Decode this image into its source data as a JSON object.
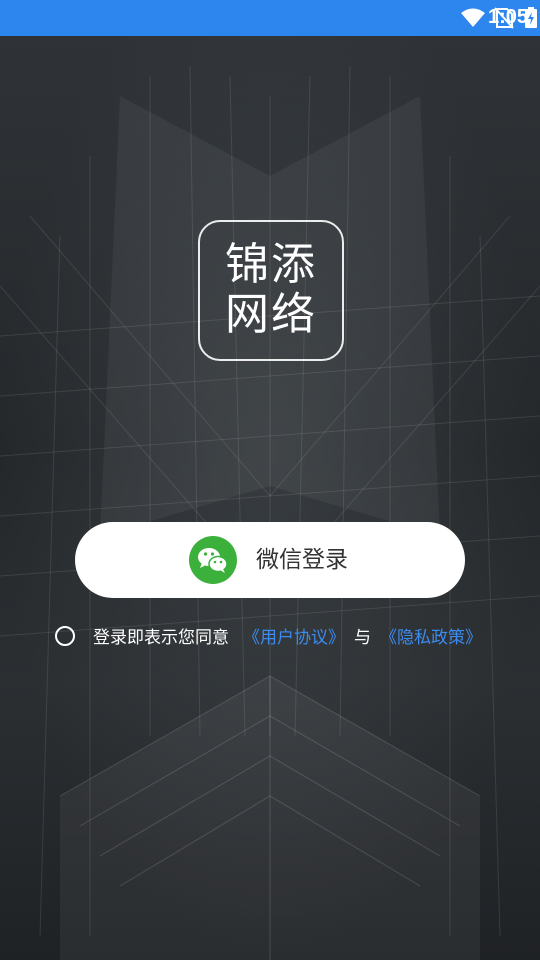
{
  "status_bar": {
    "time": "1:05",
    "icons": [
      "wifi-icon",
      "no-sim-icon",
      "battery-charging-icon"
    ],
    "color": "#2c86ee"
  },
  "logo": {
    "line1": "锦添",
    "line2": "网络"
  },
  "login": {
    "wechat_button_label": "微信登录",
    "wechat_icon": "wechat-icon",
    "wechat_color": "#3bb03b"
  },
  "agreement": {
    "prefix": "登录即表示您同意",
    "user_agreement": "《用户协议》",
    "conjunction": "与",
    "privacy_policy": "《隐私政策》",
    "link_color": "#3b8cf0"
  }
}
